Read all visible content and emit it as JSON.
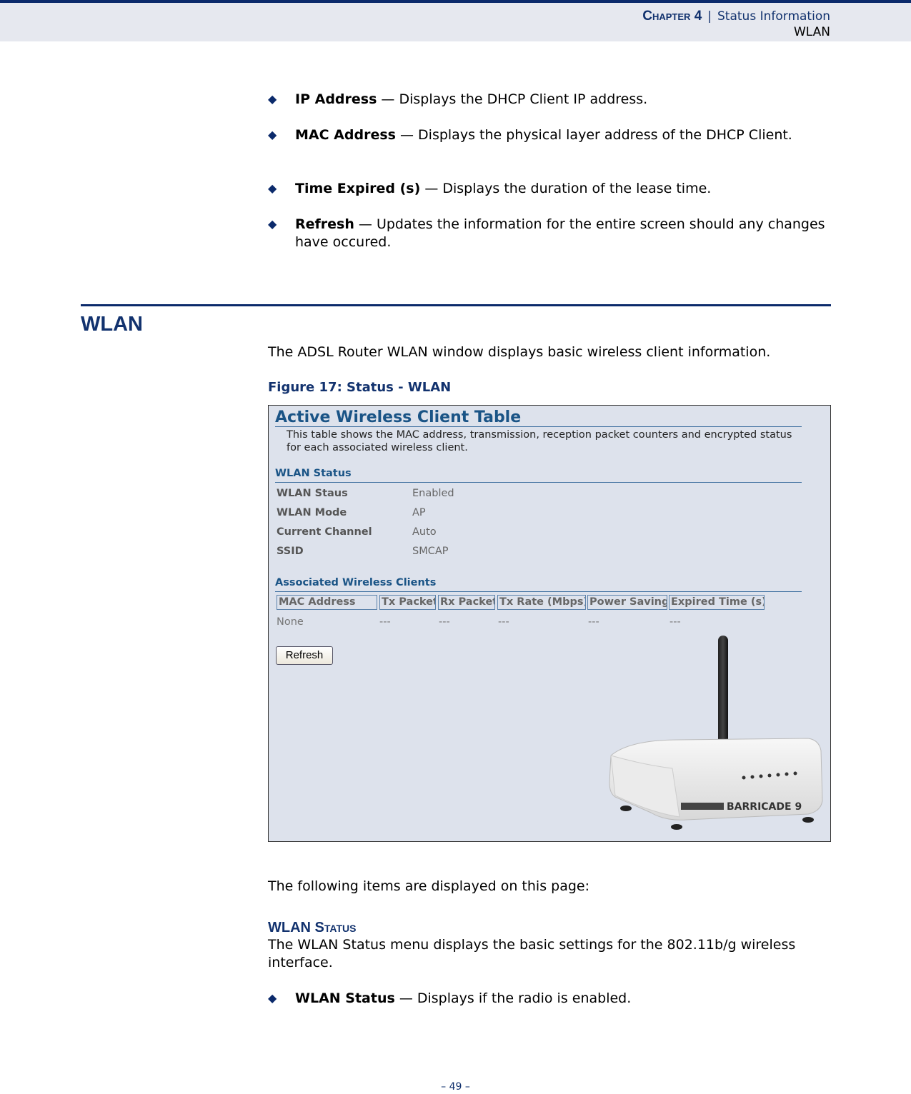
{
  "header": {
    "chapter": "Chapter 4",
    "separator": "|",
    "title": "Status Information",
    "section": "WLAN"
  },
  "dhcp_bullets": [
    {
      "term": "IP Address",
      "desc": " — Displays the DHCP Client IP address."
    },
    {
      "term": "MAC Address",
      "desc": " — Displays the physical layer address of the DHCP Client."
    },
    {
      "term": "Time Expired (s)",
      "desc": " — Displays the duration of the lease time."
    },
    {
      "term": "Refresh",
      "desc": " — Updates the information for the entire screen should any changes have occured."
    }
  ],
  "section": {
    "title": "WLAN",
    "intro": "The ADSL Router WLAN window displays basic wireless client information.",
    "figure_caption": "Figure 17:  Status - WLAN"
  },
  "figure": {
    "title": "Active Wireless Client Table",
    "description": "This table shows the MAC address, transmission, reception packet counters and encrypted status for each associated wireless client.",
    "wlan_status_heading": "WLAN Status",
    "status_rows": [
      {
        "label": "WLAN Staus",
        "value": "Enabled"
      },
      {
        "label": "WLAN Mode",
        "value": "AP"
      },
      {
        "label": "Current Channel",
        "value": "Auto"
      },
      {
        "label": "SSID",
        "value": "SMCAP"
      }
    ],
    "clients_heading": "Associated Wireless Clients",
    "columns": [
      "MAC Address",
      "Tx Packet",
      "Rx Packet",
      "Tx Rate (Mbps)",
      "Power Saving",
      "Expired Time (s)"
    ],
    "rows": [
      [
        "None",
        "---",
        "---",
        "---",
        "---",
        "---"
      ]
    ],
    "refresh_label": "Refresh",
    "router_brand": "BARRICADE 9"
  },
  "after_figure": {
    "items_intro": "The following items are displayed on this page:",
    "subhead": "WLAN Status",
    "subhead_desc": "The WLAN Status menu displays the basic settings for the 802.11b/g wireless interface.",
    "bullets": [
      {
        "term": "WLAN Status",
        "desc": " — Displays if the radio is enabled."
      }
    ]
  },
  "page_number": "–  49  –"
}
